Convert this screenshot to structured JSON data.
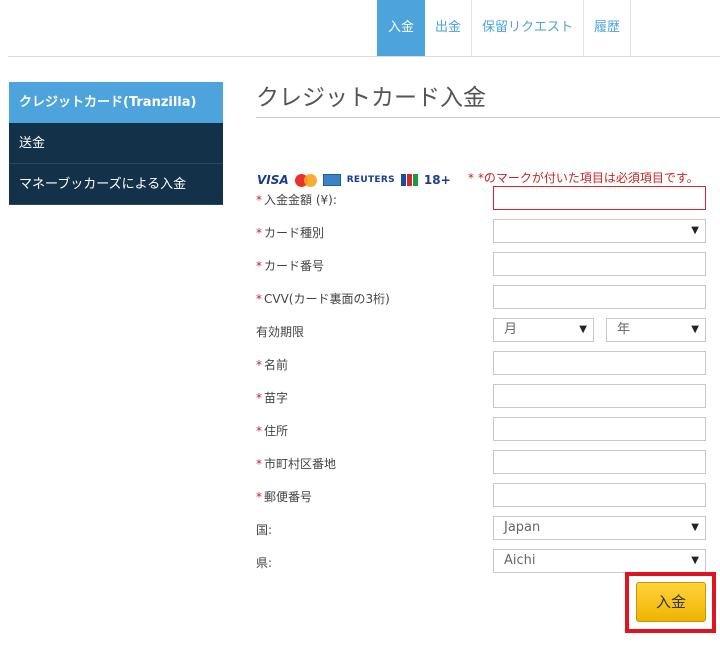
{
  "tabs": [
    {
      "label": "入金",
      "active": true
    },
    {
      "label": "出金",
      "active": false
    },
    {
      "label": "保留リクエスト",
      "active": false
    },
    {
      "label": "履歴",
      "active": false
    }
  ],
  "sidebar": {
    "items": [
      {
        "label": "クレジットカード(Tranzilla)",
        "active": true
      },
      {
        "label": "送金",
        "active": false
      },
      {
        "label": "マネーブッカーズによる入金",
        "active": false
      }
    ]
  },
  "page": {
    "title": "クレジットカード入金",
    "card_logos": {
      "visa": "VISA",
      "reuters": "REUTERS",
      "age": "18+"
    },
    "required_note": "* *のマークが付いた項目は必須項目です。"
  },
  "form": {
    "required_mark": "*",
    "amount_label": "入金金額 (¥):",
    "amount_value": "",
    "card_type_label": "カード種別",
    "card_type_value": "",
    "card_number_label": "カード番号",
    "card_number_value": "",
    "cvv_label": "CVV(カード裏面の3桁)",
    "cvv_value": "",
    "expiry_label": "有効期限",
    "expiry_month": "月",
    "expiry_year": "年",
    "first_name_label": "名前",
    "first_name_value": "",
    "last_name_label": "苗字",
    "last_name_value": "",
    "address_label": "住所",
    "address_value": "",
    "city_label": "市町村区番地",
    "city_value": "",
    "zip_label": "郵便番号",
    "zip_value": "",
    "country_label": "国:",
    "country_value": "Japan",
    "prefecture_label": "県:",
    "prefecture_value": "Aichi",
    "submit_label": "入金"
  },
  "colors": {
    "accent": "#4da3dc",
    "sidebar_bg": "#13324a",
    "error": "#d9262e",
    "button": "#f5c518"
  }
}
